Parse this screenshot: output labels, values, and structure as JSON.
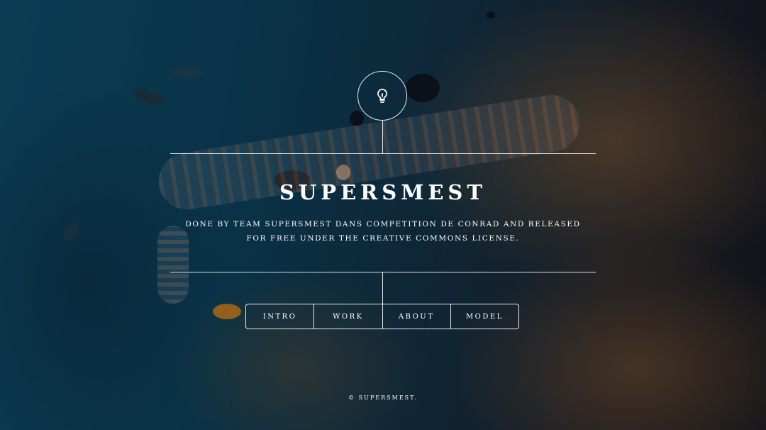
{
  "header": {
    "logo_icon": "lightbulb-icon",
    "title": "SUPERSMEST"
  },
  "intro": {
    "line1": "DONE BY TEAM SUPERSMEST DANS COMPETITION DE CONRAD AND RELEASED",
    "line2": "FOR FREE UNDER THE CREATIVE COMMONS LICENSE."
  },
  "nav": {
    "items": [
      {
        "label": "INTRO"
      },
      {
        "label": "WORK"
      },
      {
        "label": "ABOUT"
      },
      {
        "label": "MODEL"
      }
    ]
  },
  "footer": {
    "copyright": "© SUPERSMEST."
  },
  "colors": {
    "text": "#ffffff",
    "water": "#0d5470",
    "coral": "#b0733a"
  }
}
